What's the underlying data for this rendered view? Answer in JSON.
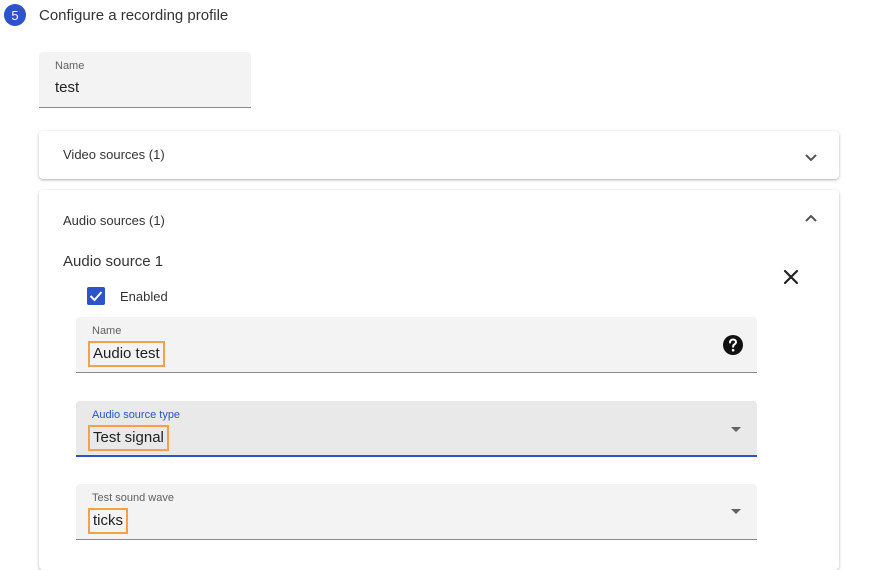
{
  "step": {
    "number": "5",
    "title": "Configure a recording profile"
  },
  "profile_name": {
    "label": "Name",
    "value": "test"
  },
  "video_panel": {
    "title": "Video sources (1)"
  },
  "audio_panel": {
    "title": "Audio sources (1)"
  },
  "audio_source": {
    "heading": "Audio source 1",
    "enabled_label": "Enabled",
    "name_label": "Name",
    "name_value": "Audio test",
    "type_label": "Audio source type",
    "type_value": "Test signal",
    "wave_label": "Test sound wave",
    "wave_value": "ticks"
  },
  "colors": {
    "accent": "#2e52c7",
    "highlight": "#f5a04a"
  },
  "icons": [
    "chevron-down-icon",
    "chevron-up-icon",
    "close-icon",
    "check-icon",
    "help-icon",
    "dropdown-caret-icon"
  ]
}
